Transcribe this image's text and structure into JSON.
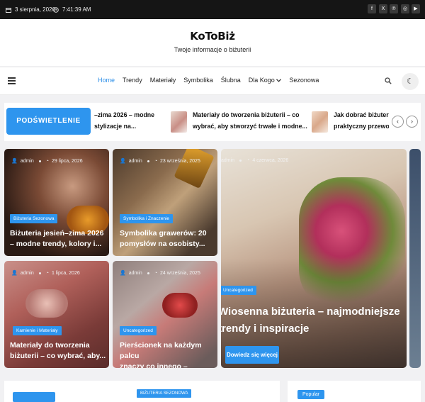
{
  "topbar": {
    "date": "3 sierpnia, 2026",
    "time": "7:41:39 AM",
    "social": [
      "facebook-icon",
      "x-icon",
      "pinterest-icon",
      "instagram-icon",
      "youtube-icon"
    ]
  },
  "site": {
    "title": "KoToBiż",
    "tagline": "Twoje informacje o biżuterii"
  },
  "nav": {
    "items": [
      "Home",
      "Trendy",
      "Materiały",
      "Symbolika",
      "Ślubna",
      "Dla Kogo",
      "Sezonowa"
    ],
    "active": "Home"
  },
  "ticker": {
    "label": "PODŚWIETLENIE",
    "items": [
      {
        "line1": "–zima 2026 – modne",
        "line2": "stylizacje na..."
      },
      {
        "line1": "Materiały do tworzenia biżuterii – co",
        "line2": "wybrać, aby stworzyć trwałe i modne..."
      },
      {
        "line1": "Jak dobrać biżuterię",
        "line2": "praktyczny przewod"
      }
    ]
  },
  "cards": [
    {
      "author": "admin",
      "date": "29 lipca, 2026",
      "category": "Biżuteria Sezonowa",
      "title1": "Biżuteria jesień–zima 2026",
      "title2": "– modne trendy, kolory i..."
    },
    {
      "author": "admin",
      "date": "23 września, 2025",
      "category": "Symbolika i Znaczenie",
      "title1": "Symbolika grawerów: 20",
      "title2": "pomysłów na osobisty..."
    },
    {
      "author": "admin",
      "date": "1 lipca, 2026",
      "category": "Kamienie i Materiały",
      "title1": "Materiały do tworzenia",
      "title2": "biżuterii – co wybrać, aby..."
    },
    {
      "author": "admin",
      "date": "24 września, 2025",
      "category": "Uncategorized",
      "title1": "Pierścionek na każdym palcu",
      "title2": "znaczy co innego – sprawd..."
    }
  ],
  "featured": {
    "author": "admin",
    "date": "4 czerwca, 2026",
    "category": "Uncategorized",
    "title1": "Wiosenna biżuteria – najmodniejsze",
    "title2": "trendy i inspiracje",
    "button": "Dowiedz się więcej"
  },
  "below": {
    "category": "BIŻUTERIA SEZONOWA",
    "button": "Popular"
  }
}
